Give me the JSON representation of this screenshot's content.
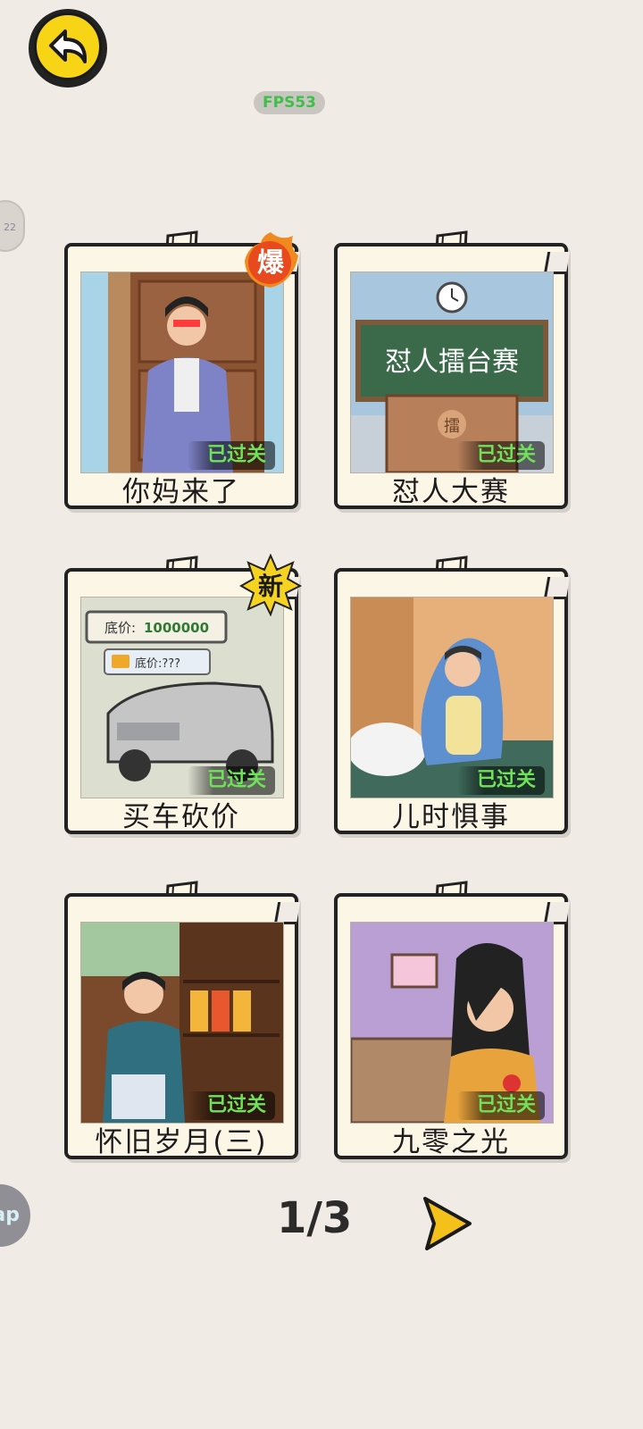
{
  "header": {
    "fps_label": "FPS53",
    "edge_hint": "22"
  },
  "levels": [
    {
      "title": "你妈来了",
      "status": "已过关",
      "badge": "爆"
    },
    {
      "title": "怼人大赛",
      "status": "已过关",
      "scene_text": "怼人擂台赛",
      "podium_char": "擂"
    },
    {
      "title": "买车砍价",
      "status": "已过关",
      "badge": "新",
      "price_label": "底价:",
      "price_value": "1000000",
      "hidden_price": "底价:???"
    },
    {
      "title": "儿时惧事",
      "status": "已过关"
    },
    {
      "title": "怀旧岁月(三)",
      "status": "已过关"
    },
    {
      "title": "九零之光",
      "status": "已过关"
    }
  ],
  "pagination": {
    "page": "1/3"
  },
  "edge_float": "ap",
  "colors": {
    "background": "#f0ebe4",
    "accent_yellow": "#f7d416",
    "passed_green": "#6fe25a"
  }
}
